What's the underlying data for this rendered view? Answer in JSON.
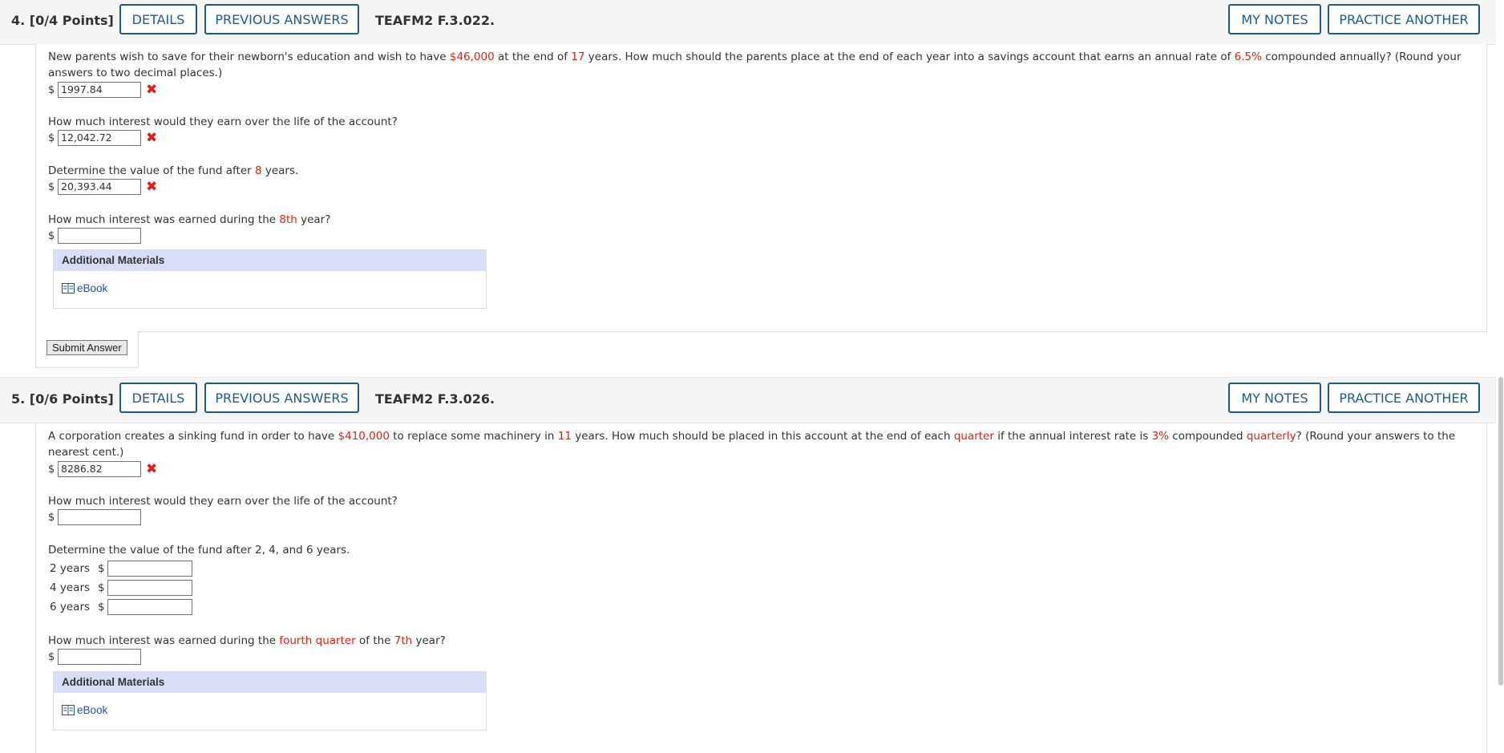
{
  "q4": {
    "number": "4.",
    "points": "[0/4 Points]",
    "details_label": "DETAILS",
    "prev_answers_label": "PREVIOUS ANSWERS",
    "code": "TEAFM2 F.3.022.",
    "my_notes_label": "MY NOTES",
    "practice_label": "PRACTICE ANOTHER",
    "prompt": {
      "p1": "New parents wish to save for their newborn's education and wish to have ",
      "amount": "$46,000",
      "p2": " at the end of ",
      "years": "17",
      "p3": " years. How much should the parents place at the end of each year into a savings account that earns an annual rate of ",
      "rate": "6.5%",
      "p4": " compounded annually? (Round your answers to two decimal places.)"
    },
    "currency": "$",
    "answer1": "1997.84",
    "q2": "How much interest would they earn over the life of the account?",
    "answer2": "12,042.72",
    "q3": {
      "p1": "Determine the value of the fund after ",
      "years": "8",
      "p2": " years."
    },
    "answer3": "20,393.44",
    "q4": {
      "p1": "How much interest was earned during the ",
      "yr": "8th",
      "p2": " year?"
    },
    "answer4": "",
    "materials_title": "Additional Materials",
    "ebook_label": "eBook",
    "submit_label": "Submit Answer"
  },
  "q5": {
    "number": "5.",
    "points": "[0/6 Points]",
    "details_label": "DETAILS",
    "prev_answers_label": "PREVIOUS ANSWERS",
    "code": "TEAFM2 F.3.026.",
    "my_notes_label": "MY NOTES",
    "practice_label": "PRACTICE ANOTHER",
    "prompt": {
      "p1": "A corporation creates a sinking fund in order to have ",
      "amount": "$410,000",
      "p2": " to replace some machinery in ",
      "years": "11",
      "p3": " years. How much should be placed in this account at the end of each ",
      "period": "quarter",
      "p4": " if the annual interest rate is ",
      "rate": "3%",
      "p5": " compounded ",
      "compounding": "quarterly",
      "p6": "? (Round your answers to the nearest cent.)"
    },
    "currency": "$",
    "answer1": "8286.82",
    "q2": "How much interest would they earn over the life of the account?",
    "q3": "Determine the value of the fund after 2, 4, and 6 years.",
    "rows": [
      {
        "label": "2 years",
        "currency": "$"
      },
      {
        "label": "4 years",
        "currency": "$"
      },
      {
        "label": "6 years",
        "currency": "$"
      }
    ],
    "q4": {
      "p1": "How much interest was earned during the ",
      "quarter": "fourth quarter",
      "p2": " of the ",
      "yr": "7th",
      "p3": " year?"
    },
    "materials_title": "Additional Materials",
    "ebook_label": "eBook"
  },
  "colors": {
    "accent": "#1e5b8c",
    "highlight": "#e8200f",
    "wrong": "#e01c1c",
    "materials_header": "#d7def6"
  },
  "icons": [
    "wrong-mark-icon",
    "ebook-icon"
  ]
}
